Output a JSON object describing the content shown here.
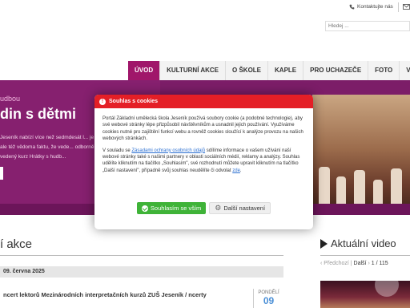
{
  "header": {
    "contact_label": "Kontaktujte nás",
    "search_placeholder": "Hledej ..."
  },
  "nav": {
    "items": [
      {
        "label": "ÚVOD",
        "active": true
      },
      {
        "label": "KULTURNÍ AKCE",
        "active": false
      },
      {
        "label": "O ŠKOLE",
        "active": false
      },
      {
        "label": "KAPLE",
        "active": false
      },
      {
        "label": "PRO UCHAZEČE",
        "active": false
      },
      {
        "label": "FOTO",
        "active": false
      },
      {
        "label": "V",
        "active": false
      }
    ],
    "active_color": "#a0166a"
  },
  "hero": {
    "subtitle": "udbou",
    "title": "din s dětmi",
    "text": "Jeseník nabízí více než sedmdesát l... je si ale též vědoma faktu, že vede... odborně vedený kurz Hrátky s hudb..."
  },
  "events": {
    "section_title": "í akce",
    "date": "09. června 2025",
    "event_title": "ncert lektorů Mezinárodních interpretačních kurzů ZUŠ Jeseník / ncerty",
    "day_name": "PONDĚLÍ",
    "day_number": "09"
  },
  "videos": {
    "section_title": "Aktuální video",
    "prev_label": "Předchozí",
    "separator": "|",
    "next_label": "Další",
    "page_indicator": "1 / 115"
  },
  "cookie_modal": {
    "title": "Souhlas s cookies",
    "paragraph1": "Portál Základní umělecká škola Jeseník používá soubory cookie (a podobné technologie), aby své webové stránky lépe přizpůsobil návštěvníkům a usnadnil jejich používání. Využíváme cookies nutné pro zajištění funkcí webu a rovněž cookies sloužící k analýze provozu na našich webových stránkách.",
    "paragraph2_before": "V souladu se ",
    "paragraph2_link": "Zásadami ochrany osobních údajů",
    "paragraph2_after": " sdílíme informace o vašem užívání naší webové stránky také s našimi partnery v oblasti sociálních médií, reklamy a analýzy. Souhlas udělíte kliknutím na tlačítko „Souhlasím\", své rozhodnutí můžete upravit kliknutím na tlačítko „Další nastavení\", případně svůj souhlas neudělíte či odvolat ",
    "paragraph2_link2": "zde",
    "paragraph2_end": ".",
    "accept_label": "Souhlasím se vším",
    "settings_label": "Další nastavení",
    "header_color": "#e41f26",
    "accept_color": "#3fb338"
  }
}
